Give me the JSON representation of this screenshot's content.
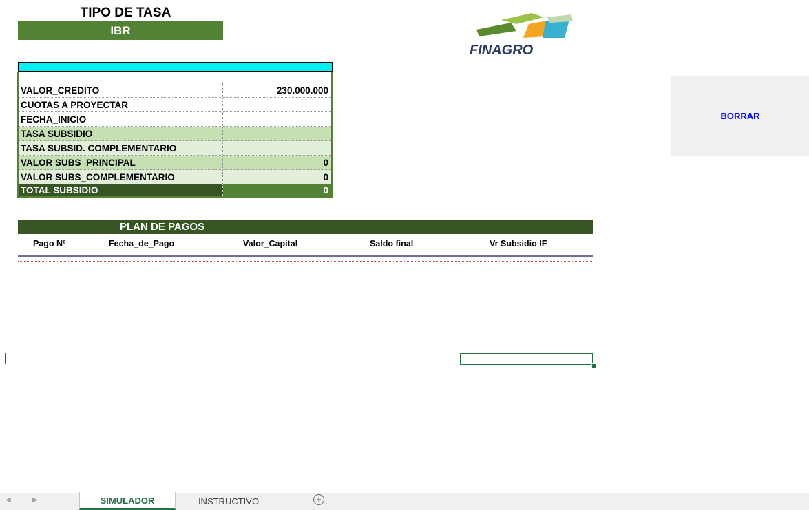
{
  "header": {
    "tasa_title": "TIPO DE TASA",
    "tasa_value": "IBR",
    "logo_text": "FINAGRO"
  },
  "summary": {
    "rows": [
      {
        "label": "VALOR_CREDITO",
        "value": "230.000.000"
      },
      {
        "label": "CUOTAS A PROYECTAR",
        "value": ""
      },
      {
        "label": "FECHA_INICIO",
        "value": ""
      },
      {
        "label": "TASA SUBSIDIO",
        "value": ""
      },
      {
        "label": "TASA SUBSID. COMPLEMENTARIO",
        "value": ""
      },
      {
        "label": "VALOR SUBS_PRINCIPAL",
        "value": "0"
      },
      {
        "label": "VALOR SUBS_COMPLEMENTARIO",
        "value": "0"
      },
      {
        "label": "TOTAL SUBSIDIO",
        "value": "0"
      }
    ]
  },
  "plan": {
    "title": "PLAN DE PAGOS",
    "columns": [
      "Pago Nº",
      "Fecha_de_Pago",
      "Valor_Capital",
      "Saldo final",
      "Vr Subsidio IF"
    ]
  },
  "actions": {
    "borrar_label": "BORRAR"
  },
  "tabs": {
    "items": [
      "SIMULADOR",
      "INSTRUCTIVO"
    ],
    "active": "SIMULADOR",
    "add_symbol": "+"
  },
  "colors": {
    "dark_green": "#375623",
    "mid_green": "#548235",
    "light_green": "#c6e0b4",
    "cyan": "#00f0f0",
    "excel_green": "#217346"
  }
}
